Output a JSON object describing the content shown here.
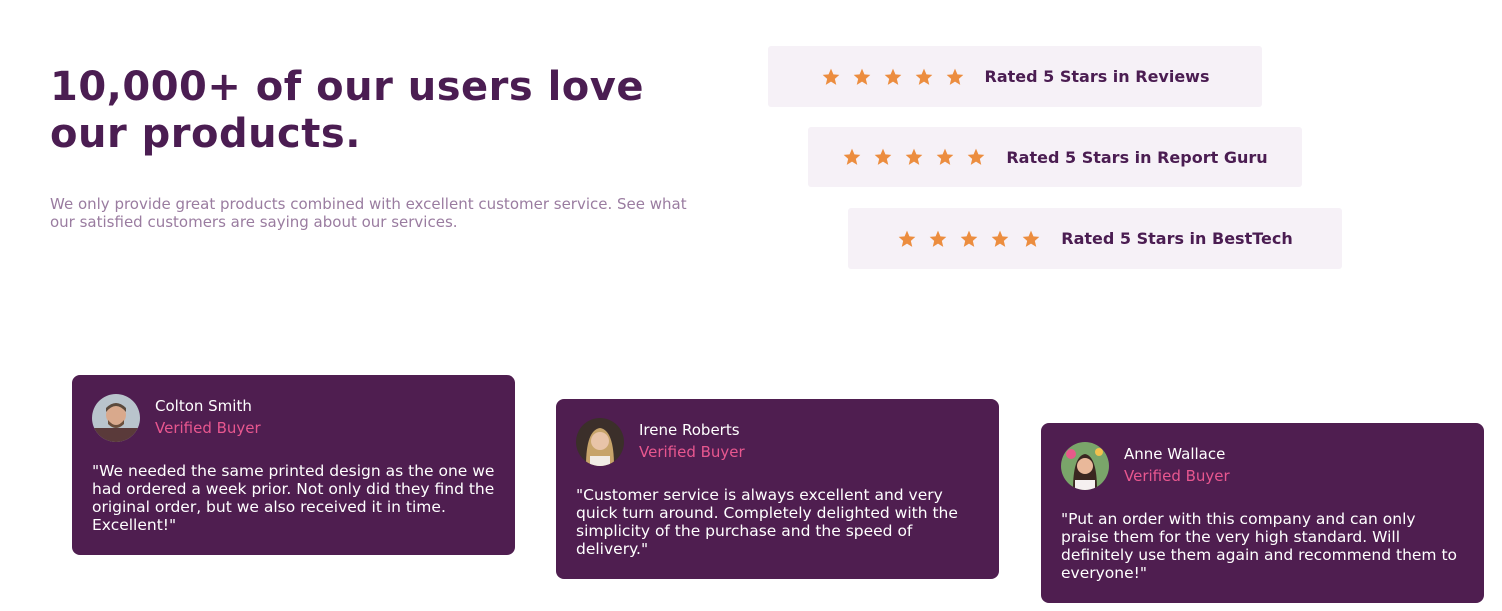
{
  "hero": {
    "headline": "10,000+ of our users love our products.",
    "subtext": "We only provide great products combined with excellent customer service. See what our satisfied customers are saying about our services."
  },
  "ratings": [
    {
      "stars": 5,
      "label": "Rated 5 Stars in Reviews"
    },
    {
      "stars": 5,
      "label": "Rated 5 Stars in Report Guru"
    },
    {
      "stars": 5,
      "label": "Rated 5 Stars in BestTech"
    }
  ],
  "testimonials": [
    {
      "name": "Colton Smith",
      "role": "Verified Buyer",
      "quote": "\"We needed the same printed design as the one we had ordered a week prior. Not only did they find the original order, but we also received it in time. Excellent!\""
    },
    {
      "name": "Irene Roberts",
      "role": "Verified Buyer",
      "quote": "\"Customer service is always excellent and very quick turn around. Completely delighted with the simplicity of the purchase and the speed of delivery.\""
    },
    {
      "name": "Anne Wallace",
      "role": "Verified Buyer",
      "quote": "\"Put an order with this company and can only praise them for the very high standard. Will definitely use them again and recommend them to everyone!\""
    }
  ],
  "colors": {
    "brand_purple": "#4f1e50",
    "star_orange": "#ec8d3f",
    "verified_pink": "#e8578f",
    "rating_bg": "#f6f1f7"
  },
  "icons": {
    "star": "star-icon"
  }
}
